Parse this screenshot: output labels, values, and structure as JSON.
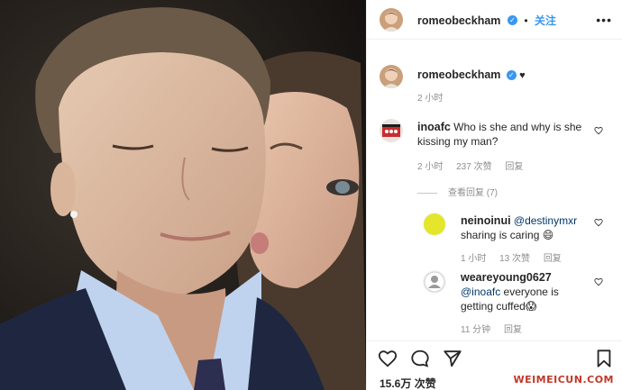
{
  "post": {
    "author": "romeobeckham",
    "follow_label": "关注",
    "separator": "•",
    "caption_heart": "♥",
    "caption_time": "2 小时",
    "more_label": "•••"
  },
  "comments": [
    {
      "user": "inoafc",
      "text": "Who is she and why is she kissing my man?",
      "time": "2 小时",
      "likes": "237 次赞",
      "reply_label": "回复",
      "view_replies": "查看回复 (7)"
    }
  ],
  "replies": [
    {
      "user": "neinoinui",
      "mention": "@destinymxr",
      "text": "sharing is caring 😄",
      "time": "1 小时",
      "likes": "13 次赞",
      "reply_label": "回复"
    },
    {
      "user": "weareyoung0627",
      "mention": "@inoafc",
      "text": "everyone is getting cuffed😱",
      "time": "11 分钟",
      "reply_label": "回复"
    }
  ],
  "footer": {
    "likes": "15.6万 次赞",
    "watermark": "WEIMEICUN.COM"
  },
  "colors": {
    "accent": "#3897f0",
    "text": "#262626",
    "muted": "#8e8e8e"
  },
  "icons": [
    "heart-icon",
    "comment-icon",
    "share-icon",
    "bookmark-icon",
    "verified-icon",
    "more-icon"
  ]
}
